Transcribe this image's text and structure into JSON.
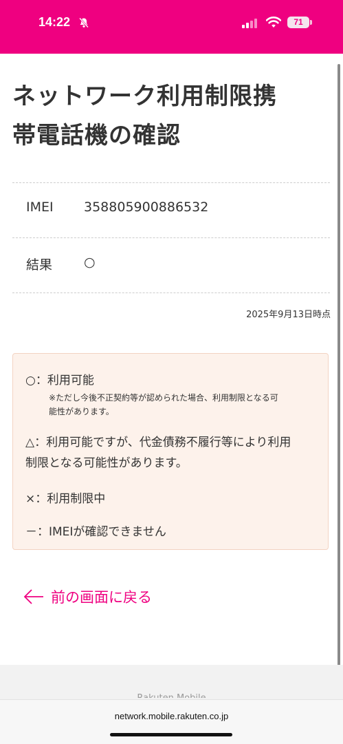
{
  "status_bar": {
    "time": "14:22",
    "battery": "71",
    "icons": [
      "bell-slash-icon",
      "signal-icon",
      "wifi-icon",
      "battery-icon"
    ],
    "background": "#ef0080"
  },
  "page": {
    "title_line1": "ネットワーク利用制限携",
    "title_line2": "帯電話機の確認"
  },
  "table": {
    "rows": [
      {
        "label": "IMEI",
        "value": "358805900886532"
      },
      {
        "label": "結果",
        "value": "○"
      }
    ],
    "as_of": "2025年9月13日時点"
  },
  "legend": {
    "items": [
      {
        "symbol": "○",
        "text": "：利用可能",
        "note_line1": "※ただし今後不正契約等が認められた場合、利用制限となる可",
        "note_line2": "能性があります。"
      },
      {
        "symbol": "△",
        "text_line1": "：利用可能ですが、代金債務不履行等により利用",
        "text_line2": "制限となる可能性があります。"
      },
      {
        "symbol": "×",
        "text": "：利用制限中"
      },
      {
        "symbol": "－",
        "text": "：IMEIが確認できません"
      }
    ],
    "background": "#fdf2eb"
  },
  "back_link": {
    "label": "前の画面に戻る",
    "icon": "arrow-left-icon",
    "color": "#ef0080"
  },
  "browser": {
    "url": "network.mobile.rakuten.co.jp",
    "footer_peek": "Rakuten Mobile"
  }
}
